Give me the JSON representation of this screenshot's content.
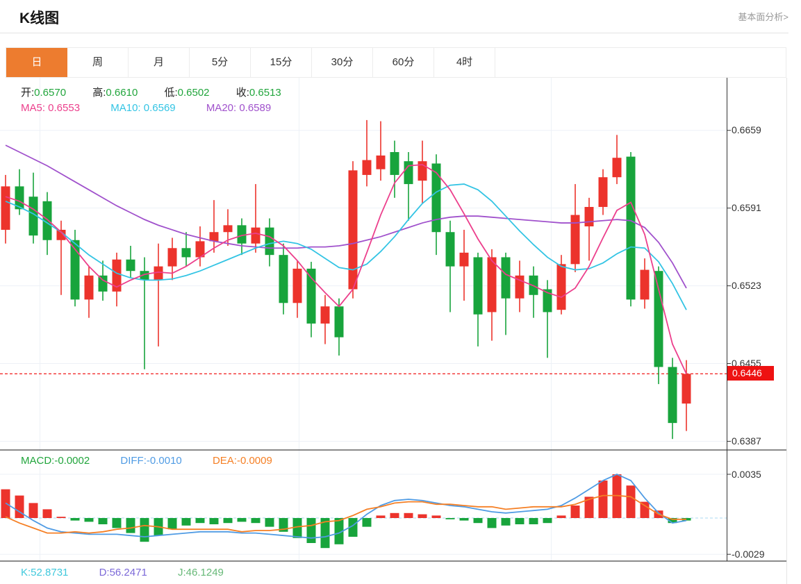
{
  "header": {
    "title": "K线图",
    "analysis_link": "基本面分析>"
  },
  "tabs": [
    {
      "label": "日",
      "active": true
    },
    {
      "label": "周",
      "active": false
    },
    {
      "label": "月",
      "active": false
    },
    {
      "label": "5分",
      "active": false
    },
    {
      "label": "15分",
      "active": false
    },
    {
      "label": "30分",
      "active": false
    },
    {
      "label": "60分",
      "active": false
    },
    {
      "label": "4时",
      "active": false
    }
  ],
  "ohlc_legend": {
    "open_label": "开:",
    "open": "0.6570",
    "high_label": "高:",
    "high": "0.6610",
    "low_label": "低:",
    "low": "0.6502",
    "close_label": "收:",
    "close": "0.6513"
  },
  "ma_legend": {
    "ma5": "MA5: 0.6553",
    "ma10": "MA10: 0.6569",
    "ma20": "MA20: 0.6589"
  },
  "macd_legend": {
    "macd": "MACD:-0.0002",
    "diff": "DIFF:-0.0010",
    "dea": "DEA:-0.0009"
  },
  "kdj_legend": {
    "k": "K:52.8731",
    "d": "D:56.2471",
    "j": "J:46.1249"
  },
  "y_axis_labels": [
    "0.6659",
    "0.6591",
    "0.6523",
    "0.6455",
    "0.6387"
  ],
  "macd_axis_labels": [
    "0.0035",
    "-0.0029"
  ],
  "price_badge": "0.6446",
  "colors": {
    "up": "#ec332c",
    "down": "#18a43c",
    "ma5": "#ec3f8c",
    "ma10": "#33c4e4",
    "ma20": "#a051cc",
    "diff": "#4f9be4",
    "dea": "#f57f24",
    "tab_accent": "#ed7c2f",
    "badge": "#ee1212",
    "grid": "#edf1f7",
    "axis": "#333333",
    "price_dash": "#f22c2c",
    "zero_dash": "#a8d8f0",
    "separator": "#161616"
  },
  "chart_data": {
    "type": "candlestick",
    "title": "K线图 (daily K-line with MA5/MA10/MA20, MACD, KDJ)",
    "panels": [
      "price",
      "macd",
      "kdj"
    ],
    "price_axis": {
      "ticks": [
        0.6659,
        0.6591,
        0.6523,
        0.6455,
        0.6387
      ],
      "range": [
        0.638,
        0.6705
      ]
    },
    "current_price": 0.6446,
    "candles": [
      [
        0.6572,
        0.662,
        0.656,
        0.661
      ],
      [
        0.661,
        0.6625,
        0.6585,
        0.659
      ],
      [
        0.6601,
        0.6622,
        0.656,
        0.6567
      ],
      [
        0.6597,
        0.6605,
        0.655,
        0.6563
      ],
      [
        0.6563,
        0.658,
        0.6515,
        0.6572
      ],
      [
        0.6563,
        0.6572,
        0.6505,
        0.6511
      ],
      [
        0.6511,
        0.654,
        0.6495,
        0.6532
      ],
      [
        0.6532,
        0.6545,
        0.651,
        0.6518
      ],
      [
        0.6518,
        0.6552,
        0.6505,
        0.6546
      ],
      [
        0.6546,
        0.6558,
        0.653,
        0.6536
      ],
      [
        0.6536,
        0.6548,
        0.645,
        0.6528
      ],
      [
        0.6528,
        0.656,
        0.647,
        0.654
      ],
      [
        0.654,
        0.6565,
        0.6528,
        0.6556
      ],
      [
        0.6556,
        0.657,
        0.654,
        0.6548
      ],
      [
        0.6548,
        0.6575,
        0.654,
        0.6562
      ],
      [
        0.6562,
        0.6598,
        0.6552,
        0.657
      ],
      [
        0.657,
        0.659,
        0.6558,
        0.6576
      ],
      [
        0.6576,
        0.6582,
        0.655,
        0.656
      ],
      [
        0.656,
        0.6612,
        0.6552,
        0.6574
      ],
      [
        0.6574,
        0.6582,
        0.654,
        0.655
      ],
      [
        0.655,
        0.656,
        0.6498,
        0.6508
      ],
      [
        0.6508,
        0.6545,
        0.6495,
        0.6538
      ],
      [
        0.6538,
        0.6544,
        0.6478,
        0.649
      ],
      [
        0.649,
        0.6515,
        0.6472,
        0.6505
      ],
      [
        0.6505,
        0.6512,
        0.6462,
        0.6478
      ],
      [
        0.652,
        0.6632,
        0.6512,
        0.6624
      ],
      [
        0.662,
        0.6668,
        0.661,
        0.6633
      ],
      [
        0.6625,
        0.6667,
        0.6615,
        0.6637
      ],
      [
        0.664,
        0.665,
        0.66,
        0.662
      ],
      [
        0.6632,
        0.664,
        0.658,
        0.6612
      ],
      [
        0.6615,
        0.665,
        0.6595,
        0.6632
      ],
      [
        0.663,
        0.6638,
        0.655,
        0.657
      ],
      [
        0.657,
        0.658,
        0.65,
        0.654
      ],
      [
        0.654,
        0.6572,
        0.651,
        0.6552
      ],
      [
        0.6548,
        0.6552,
        0.647,
        0.6498
      ],
      [
        0.65,
        0.6555,
        0.6475,
        0.6548
      ],
      [
        0.6548,
        0.6552,
        0.648,
        0.6512
      ],
      [
        0.6512,
        0.6545,
        0.65,
        0.6532
      ],
      [
        0.6532,
        0.654,
        0.6495,
        0.6515
      ],
      [
        0.652,
        0.6528,
        0.646,
        0.65
      ],
      [
        0.6502,
        0.655,
        0.6498,
        0.6542
      ],
      [
        0.6542,
        0.6612,
        0.6535,
        0.6585
      ],
      [
        0.6575,
        0.66,
        0.6545,
        0.6592
      ],
      [
        0.6592,
        0.6625,
        0.6585,
        0.6618
      ],
      [
        0.6618,
        0.6655,
        0.6612,
        0.6635
      ],
      [
        0.6636,
        0.664,
        0.6505,
        0.6511
      ],
      [
        0.6511,
        0.6547,
        0.6503,
        0.6537
      ],
      [
        0.6536,
        0.654,
        0.6437,
        0.6452
      ],
      [
        0.6452,
        0.646,
        0.6389,
        0.6403
      ],
      [
        0.642,
        0.6458,
        0.6396,
        0.6446
      ]
    ],
    "ma5": [
      0.6601,
      0.6597,
      0.659,
      0.6581,
      0.657,
      0.6555,
      0.654,
      0.6528,
      0.6522,
      0.6528,
      0.6533,
      0.6535,
      0.6534,
      0.654,
      0.6548,
      0.6556,
      0.6563,
      0.6567,
      0.6569,
      0.6566,
      0.6558,
      0.6545,
      0.653,
      0.6517,
      0.6505,
      0.652,
      0.6552,
      0.6585,
      0.6613,
      0.6628,
      0.6629,
      0.6622,
      0.6607,
      0.6586,
      0.6564,
      0.6545,
      0.6533,
      0.6528,
      0.6523,
      0.6517,
      0.6513,
      0.6521,
      0.654,
      0.6565,
      0.6589,
      0.6596,
      0.6568,
      0.652,
      0.6472,
      0.6446
    ],
    "ma10": [
      0.6597,
      0.6592,
      0.6586,
      0.6578,
      0.657,
      0.656,
      0.655,
      0.6542,
      0.6534,
      0.653,
      0.6528,
      0.6528,
      0.6529,
      0.6532,
      0.6536,
      0.6541,
      0.6546,
      0.6551,
      0.6556,
      0.656,
      0.6562,
      0.656,
      0.6555,
      0.6547,
      0.6539,
      0.6537,
      0.6542,
      0.6553,
      0.6566,
      0.6581,
      0.6595,
      0.6605,
      0.6611,
      0.6612,
      0.6607,
      0.6597,
      0.6584,
      0.6571,
      0.6559,
      0.6548,
      0.654,
      0.6537,
      0.6538,
      0.6543,
      0.6551,
      0.6557,
      0.6556,
      0.6544,
      0.6525,
      0.6502
    ],
    "ma20": [
      0.6646,
      0.664,
      0.6634,
      0.6628,
      0.6621,
      0.6614,
      0.6607,
      0.66,
      0.6593,
      0.6587,
      0.6581,
      0.6576,
      0.6572,
      0.6568,
      0.6565,
      0.6562,
      0.656,
      0.6558,
      0.6557,
      0.6556,
      0.6556,
      0.6556,
      0.6557,
      0.6557,
      0.6558,
      0.656,
      0.6563,
      0.6566,
      0.657,
      0.6574,
      0.6578,
      0.6581,
      0.6583,
      0.6584,
      0.6584,
      0.6583,
      0.6582,
      0.6581,
      0.658,
      0.6579,
      0.6578,
      0.6578,
      0.6579,
      0.658,
      0.6581,
      0.658,
      0.6574,
      0.6561,
      0.6543,
      0.6521
    ],
    "macd": {
      "axis_ticks": [
        0.0035,
        -0.0029
      ],
      "histogram": [
        0.0023,
        0.0018,
        0.0012,
        0.0007,
        0.0001,
        -0.0002,
        -0.0003,
        -0.0005,
        -0.0008,
        -0.0012,
        -0.0019,
        -0.0014,
        -0.0009,
        -0.0006,
        -0.0004,
        -0.0005,
        -0.0004,
        -0.0003,
        -0.0004,
        -0.0007,
        -0.0011,
        -0.0016,
        -0.002,
        -0.0024,
        -0.0021,
        -0.0015,
        -0.0007,
        0.0002,
        0.0004,
        0.0004,
        0.0003,
        0.0002,
        -0.0001,
        -0.0002,
        -0.0004,
        -0.0008,
        -0.0006,
        -0.0005,
        -0.0005,
        -0.0004,
        0.0002,
        0.001,
        0.0017,
        0.003,
        0.0035,
        0.0026,
        0.0013,
        0.0006,
        -0.0004,
        -0.0002
      ],
      "diff": [
        0.0012,
        0.0005,
        -0.0002,
        -0.0008,
        -0.0011,
        -0.0012,
        -0.0013,
        -0.0013,
        -0.0013,
        -0.0014,
        -0.0015,
        -0.0014,
        -0.0013,
        -0.0012,
        -0.0011,
        -0.0011,
        -0.0011,
        -0.0012,
        -0.0012,
        -0.0013,
        -0.0014,
        -0.0015,
        -0.0016,
        -0.0015,
        -0.0012,
        -0.0006,
        0.0003,
        0.001,
        0.0014,
        0.0015,
        0.0014,
        0.0012,
        0.001,
        0.0009,
        0.0007,
        0.0005,
        0.0004,
        0.0005,
        0.0006,
        0.0007,
        0.001,
        0.0016,
        0.0023,
        0.003,
        0.0035,
        0.003,
        0.0016,
        0.0004,
        -0.0004,
        -0.0002
      ],
      "dea": [
        0.0001,
        -0.0004,
        -0.0008,
        -0.0012,
        -0.0012,
        -0.0011,
        -0.0012,
        -0.0011,
        -0.0009,
        -0.0008,
        -0.0006,
        -0.0007,
        -0.0009,
        -0.0009,
        -0.0009,
        -0.0009,
        -0.0009,
        -0.0011,
        -0.001,
        -0.001,
        -0.0009,
        -0.0007,
        -0.0006,
        -0.0003,
        -0.0002,
        0.0002,
        0.0007,
        0.0009,
        0.0012,
        0.0013,
        0.0013,
        0.0011,
        0.0011,
        0.001,
        0.0009,
        0.0009,
        0.0007,
        0.0008,
        0.0009,
        0.0009,
        0.0009,
        0.0011,
        0.0015,
        0.0018,
        0.0018,
        0.0017,
        0.001,
        0.0003,
        -0.0001,
        -0.0001
      ]
    },
    "kdj": {
      "k": 52.8731,
      "d": 56.2471,
      "j": 46.1249
    }
  }
}
